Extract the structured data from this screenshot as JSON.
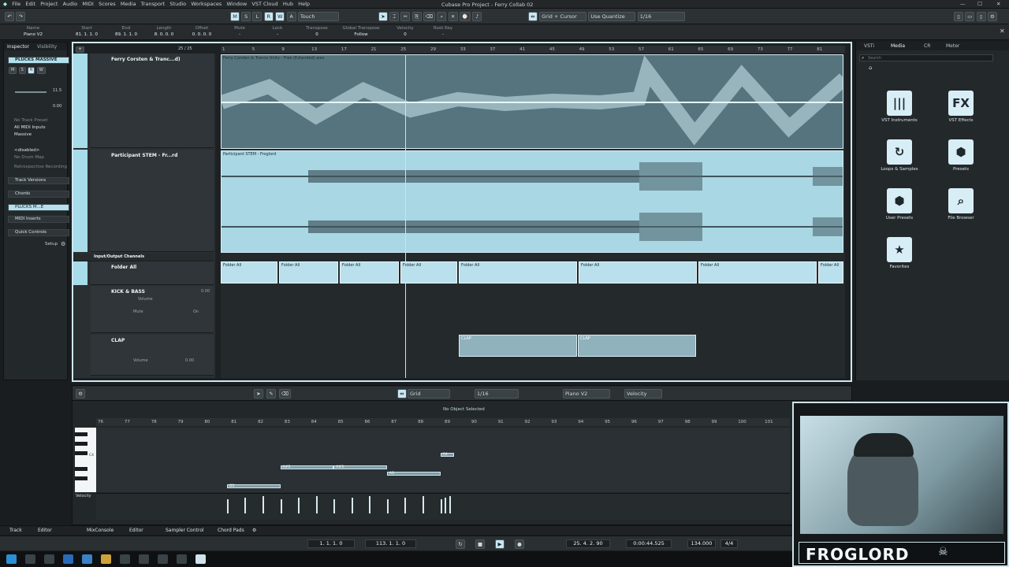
{
  "menu": {
    "items": [
      "File",
      "Edit",
      "Project",
      "Audio",
      "MIDI",
      "Scores",
      "Media",
      "Transport",
      "Studio",
      "Workspaces",
      "Window",
      "VST Cloud",
      "Hub",
      "Help"
    ],
    "window_title": "Cubase Pro Project - Ferry Collab 02"
  },
  "toolbar": {
    "mode_buttons": [
      "M",
      "S",
      "L",
      "R",
      "W",
      "A"
    ],
    "automation_mode": "Touch",
    "snap_type": "Grid + Cursor",
    "quantize_type": "Use Quantize",
    "quantize_value": "1/16"
  },
  "infoline": {
    "columns": [
      {
        "label": "Name",
        "value": "Piano V2"
      },
      {
        "label": "Start",
        "value": "81. 1. 1.   0"
      },
      {
        "label": "End",
        "value": "89. 1. 1.   0"
      },
      {
        "label": "Length",
        "value": "8. 0. 0.   0"
      },
      {
        "label": "Offset",
        "value": "0. 0. 0.   0"
      },
      {
        "label": "Mute",
        "value": "-"
      },
      {
        "label": "Lock",
        "value": "-"
      },
      {
        "label": "Transpose",
        "value": "0"
      },
      {
        "label": "Global Transpose",
        "value": "Follow"
      },
      {
        "label": "Velocity",
        "value": "0"
      },
      {
        "label": "Root Key",
        "value": "-"
      }
    ]
  },
  "inspector": {
    "tabs": [
      "Inspector",
      "Visibility"
    ],
    "track_name": "PLUCKS MASSIVE",
    "pan_value": "0.00",
    "volume_value": "11.5",
    "routing": [
      "No Track Preset",
      "All MIDI Inputs",
      "Massive"
    ],
    "disabled_label": "<disabled>",
    "no_drum_map": "No Drum Map",
    "retrospective": "Retrospective Recording",
    "sections": [
      "Track Versions",
      "Chords",
      "PLUCKS M...E",
      "MIDI Inserts",
      "Quick Controls"
    ],
    "setup_label": "Setup"
  },
  "project": {
    "track_count": "25 / 25",
    "ruler_marks": [
      "1",
      "5",
      "9",
      "13",
      "17",
      "21",
      "25",
      "29",
      "33",
      "37",
      "41",
      "45",
      "49",
      "53",
      "57",
      "61",
      "65",
      "69",
      "73",
      "77",
      "81"
    ],
    "tracks": [
      {
        "name": "Ferry Corsten & Tranc...d)",
        "event_label": "Ferry Corsten & Trance Unity - Free (Extended).wav"
      },
      {
        "name": "Participant STEM - Fr...rd",
        "event_label": "Participant STEM - Froglord"
      },
      {
        "name": "Input/Output Channels",
        "event_label": ""
      },
      {
        "name": "Folder All",
        "event_label": "Folder All"
      },
      {
        "name": "KICK & BASS",
        "event_label": ""
      },
      {
        "name": "CLAP",
        "event_label": "CLAP"
      }
    ],
    "kick_param": "Volume",
    "kick_mute": "Mute",
    "clap_param": "Volume",
    "clap_value": "0.00",
    "kick_value": "0.00",
    "kick_sub": "On"
  },
  "right_zone": {
    "tabs": [
      "VSTi",
      "Media",
      "CR",
      "Meter"
    ],
    "search_placeholder": "Search",
    "tiles": [
      {
        "label": "VST Instruments",
        "glyph": "|||"
      },
      {
        "label": "VST Effects",
        "glyph": "FX"
      },
      {
        "label": "Loops & Samples",
        "glyph": "↻"
      },
      {
        "label": "Presets",
        "glyph": "⬢"
      },
      {
        "label": "User Presets",
        "glyph": "⬢"
      },
      {
        "label": "File Browser",
        "glyph": "⌕"
      },
      {
        "label": "Favorites",
        "glyph": "★"
      }
    ]
  },
  "lower_zone": {
    "snap": "Grid",
    "quantize": "1/16",
    "part_name": "Piano V2",
    "controller": "Velocity",
    "status": "No Object Selected",
    "ruler_marks": [
      "76",
      "77",
      "78",
      "79",
      "80",
      "81",
      "82",
      "83",
      "84",
      "85",
      "86",
      "87",
      "88",
      "89",
      "90",
      "91",
      "92",
      "93",
      "94",
      "95",
      "96",
      "97",
      "98",
      "99",
      "100",
      "101"
    ],
    "key_label": "C4",
    "velocity_label": "Velocity",
    "notes": [
      {
        "label": "C4",
        "start": 88.9,
        "length": 0.5,
        "row": 4
      },
      {
        "label": "A#3",
        "start": 82.9,
        "length": 2,
        "row": 6
      },
      {
        "label": "A#3",
        "start": 84.9,
        "length": 2,
        "row": 6
      },
      {
        "label": "A3",
        "start": 86.9,
        "length": 2,
        "row": 7
      },
      {
        "label": "G3",
        "start": 80.9,
        "length": 2,
        "row": 9
      }
    ]
  },
  "bottom_tabs": [
    "Track",
    "Editor",
    "MixConsole",
    "Editor",
    "Sampler Control",
    "Chord Pads"
  ],
  "transport": {
    "left_locator": "1.  1.  1.   0",
    "right_locator": "113.  1.  1.   0",
    "position_bars": "25.  4.  2.  90",
    "position_time": "0:00:44.525",
    "tempo": "134.000",
    "signature": "4/4"
  },
  "webcam": {
    "overlay_name": "FROGLORD"
  },
  "colors": {
    "accent": "#a8dcea",
    "event_audio_dark": "#5b7a84",
    "event_audio_light": "#a9d7e4",
    "frame": "#cfe9f3"
  }
}
